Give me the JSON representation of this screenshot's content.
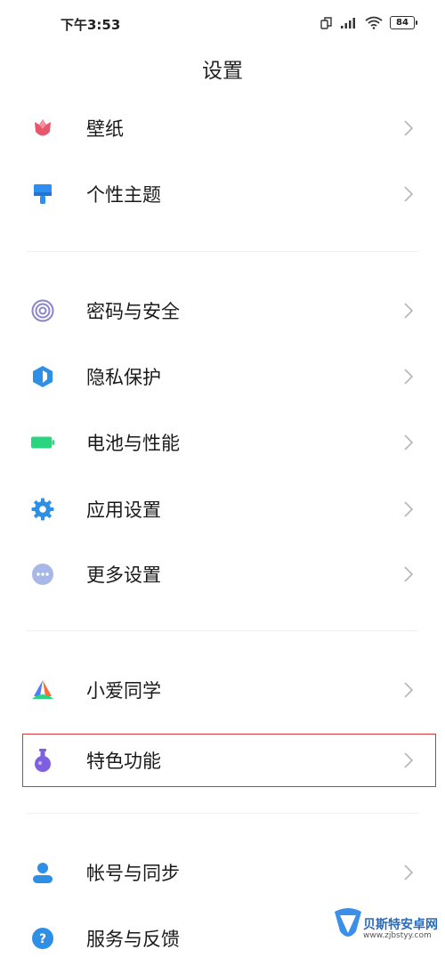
{
  "status": {
    "time": "下午3:53",
    "battery": "84"
  },
  "header": {
    "title": "设置"
  },
  "settings": {
    "wallpaper": "壁纸",
    "theme": "个性主题",
    "password": "密码与安全",
    "privacy": "隐私保护",
    "battery": "电池与性能",
    "apps": "应用设置",
    "more": "更多设置",
    "xiaoai": "小爱同学",
    "special": "特色功能",
    "account": "帐号与同步",
    "feedback": "服务与反馈"
  },
  "watermark": {
    "name": "贝斯特安卓网",
    "url": "www.zjbstyy.com"
  },
  "colors": {
    "highlight": "#d23a3a",
    "accent": "#3b8fe8"
  }
}
